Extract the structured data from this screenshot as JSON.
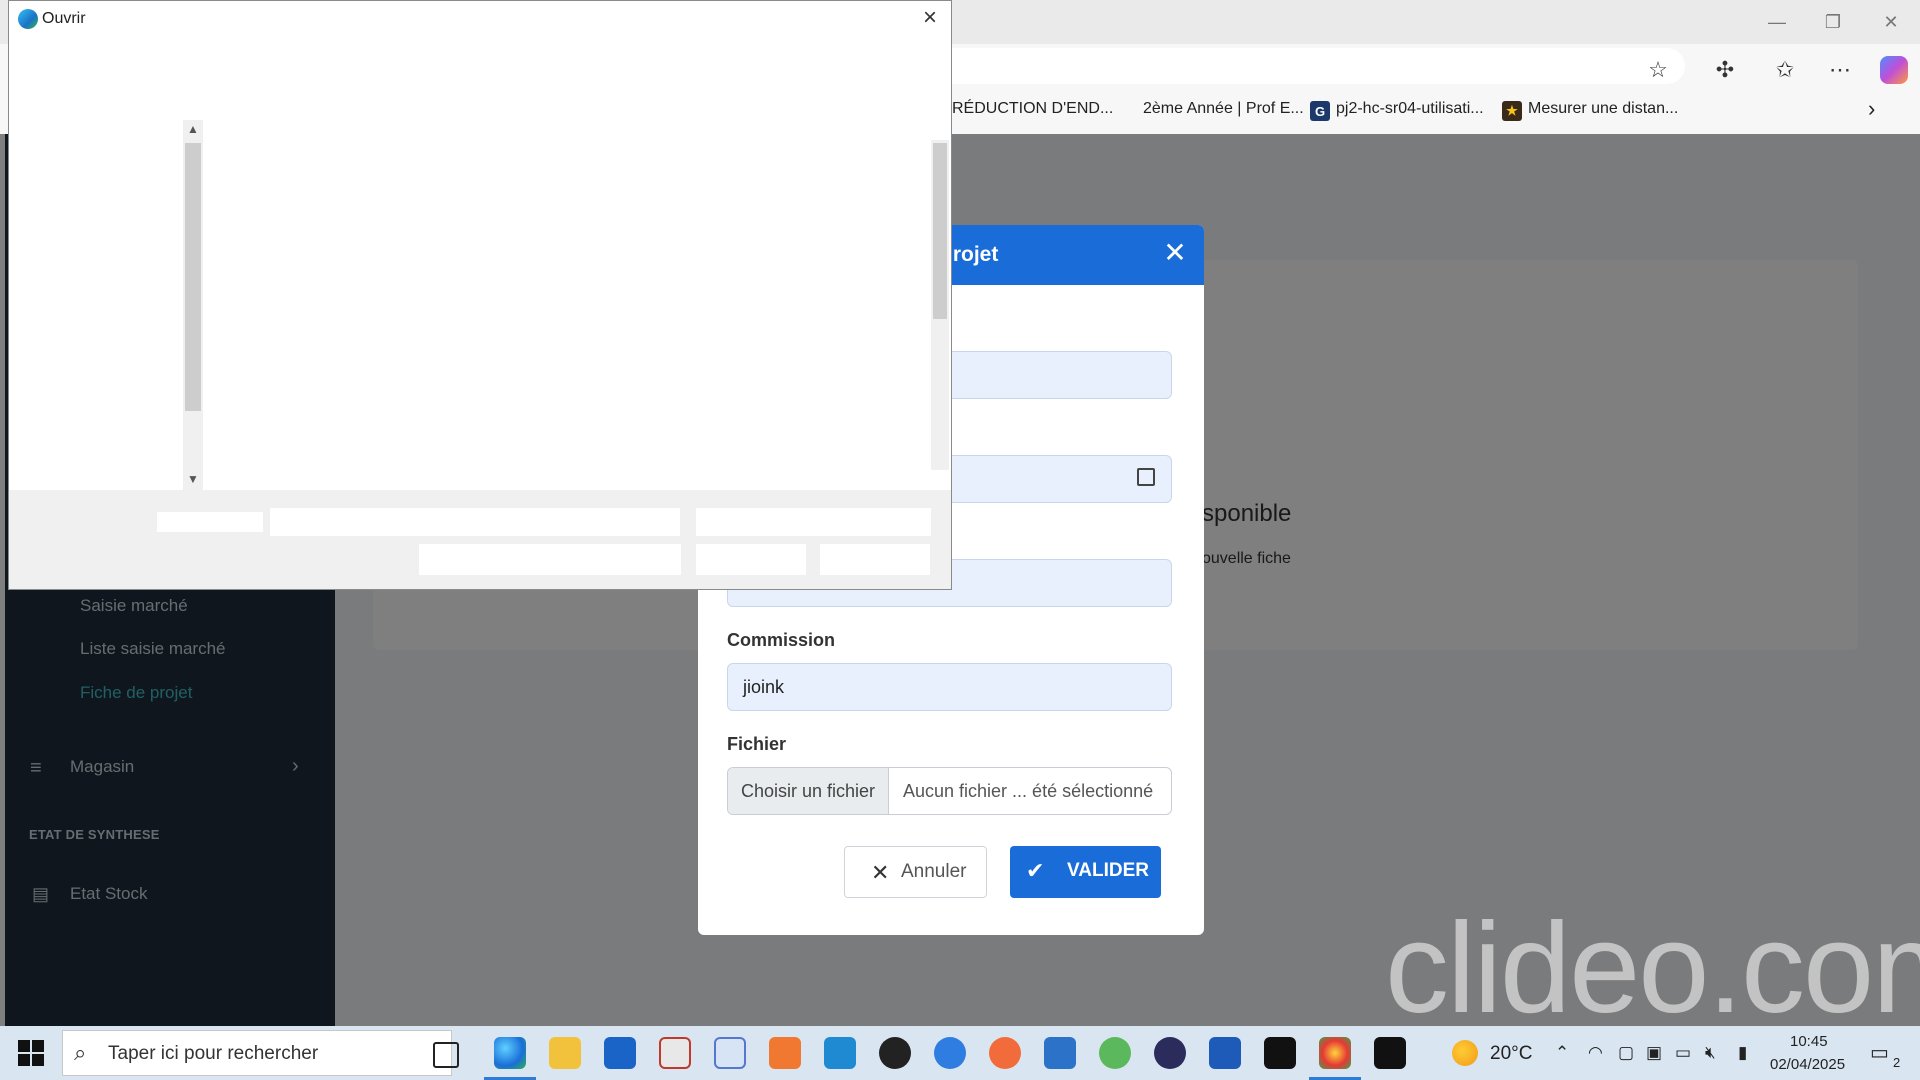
{
  "browser": {
    "bookmarks": [
      {
        "label": "RÉDUCTION D'END...",
        "icon": ""
      },
      {
        "label": "2ème Année | Prof E...",
        "icon": ""
      },
      {
        "label": "pj2-hc-sr04-utilisati...",
        "icon": "G"
      },
      {
        "label": "Mesurer une distan...",
        "icon": "star-icon"
      }
    ]
  },
  "sidebar": {
    "items": [
      {
        "label": "Saisie marché"
      },
      {
        "label": "Liste saisie marché"
      },
      {
        "label": "Fiche de projet",
        "active": true
      }
    ],
    "magasin": "Magasin",
    "section_title": "ETAT DE SYNTHESE",
    "etat_stock": "Etat Stock"
  },
  "card": {
    "empty_title": "sponible",
    "empty_sub": "ouvelle fiche"
  },
  "modal": {
    "title": "projet",
    "commission_label": "Commission",
    "commission_value": "jioink",
    "file_label": "Fichier",
    "file_button": "Choisir un fichier",
    "file_status": "Aucun fichier ... été sélectionné",
    "cancel_label": "Annuler",
    "submit_label": "VALIDER"
  },
  "dialog": {
    "title": "Ouvrir"
  },
  "watermark": "clideo.com",
  "taskbar": {
    "search_placeholder": "Taper ici pour rechercher",
    "weather": "20°C",
    "time": "10:45",
    "date": "02/04/2025",
    "notifications": "2"
  },
  "colors": {
    "primary": "#1a6cd8",
    "sidebar": "#1f2d3a",
    "active_link": "#3fc1c9"
  }
}
